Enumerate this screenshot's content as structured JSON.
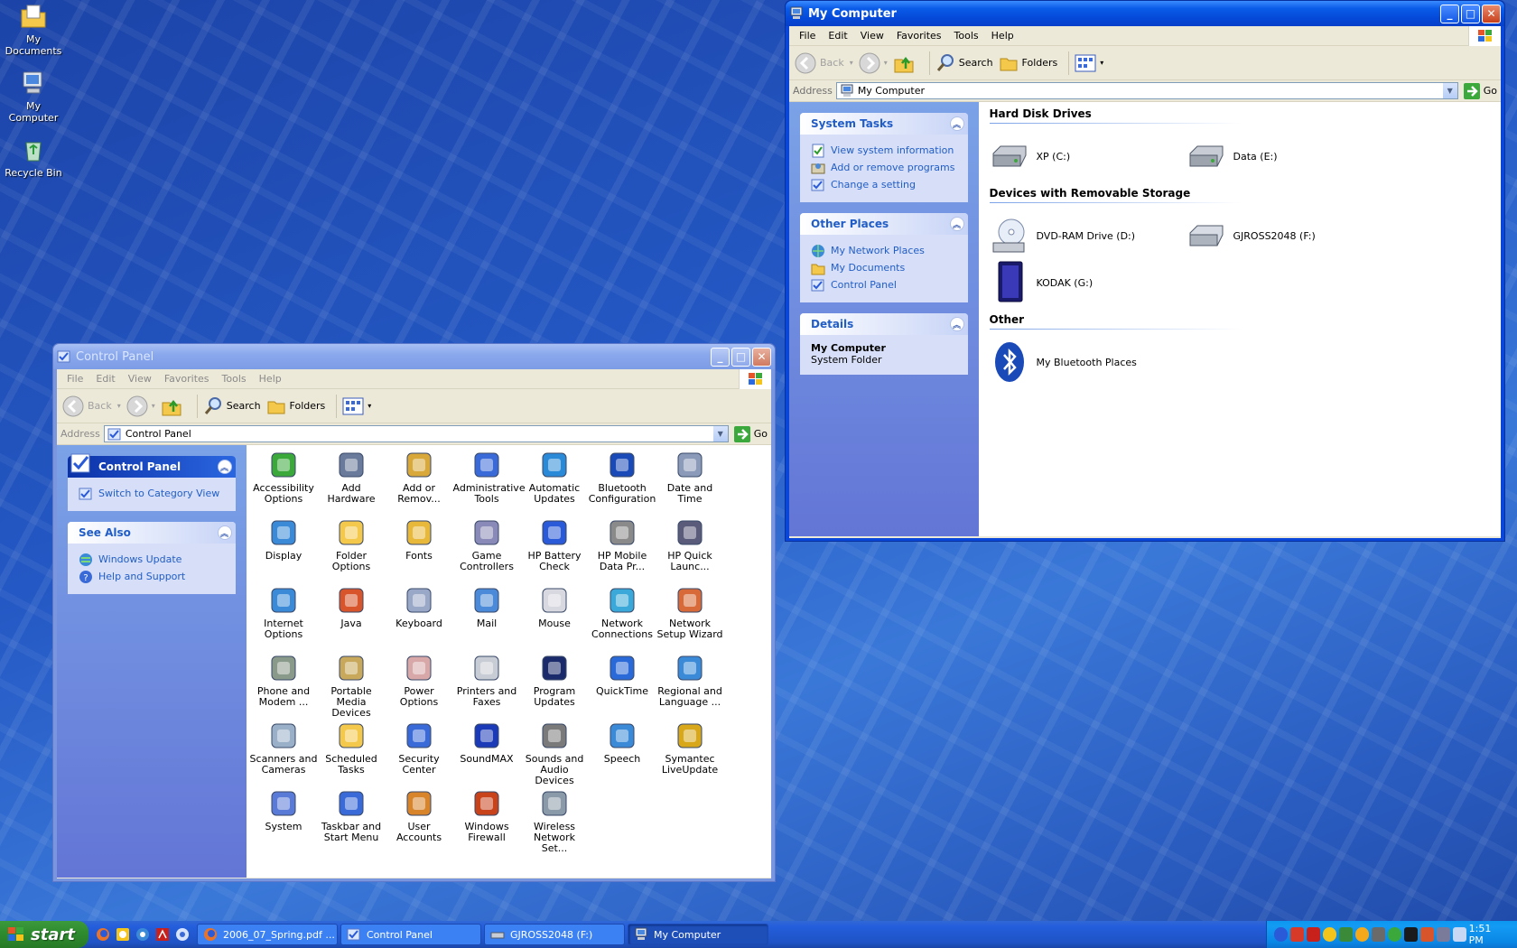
{
  "desktop": {
    "icons": [
      {
        "label": "My Documents"
      },
      {
        "label": "My Computer"
      },
      {
        "label": "Recycle Bin"
      }
    ]
  },
  "control_panel": {
    "title": "Control Panel",
    "menu": [
      "File",
      "Edit",
      "View",
      "Favorites",
      "Tools",
      "Help"
    ],
    "toolbar": {
      "back": "Back",
      "search": "Search",
      "folders": "Folders"
    },
    "address_label": "Address",
    "address_value": "Control Panel",
    "go": "Go",
    "panel_main": {
      "title": "Control Panel",
      "link": "Switch to Category View"
    },
    "panel_see_also": {
      "title": "See Also",
      "links": [
        "Windows Update",
        "Help and Support"
      ]
    },
    "items": [
      "Accessibility Options",
      "Add Hardware",
      "Add or Remov...",
      "Administrative Tools",
      "Automatic Updates",
      "Bluetooth Configuration",
      "Date and Time",
      "Display",
      "Folder Options",
      "Fonts",
      "Game Controllers",
      "HP Battery Check",
      "HP Mobile Data Pr...",
      "HP Quick Launc...",
      "Internet Options",
      "Java",
      "Keyboard",
      "Mail",
      "Mouse",
      "Network Connections",
      "Network Setup Wizard",
      "Phone and Modem ...",
      "Portable Media Devices",
      "Power Options",
      "Printers and Faxes",
      "Program Updates",
      "QuickTime",
      "Regional and Language ...",
      "Scanners and Cameras",
      "Scheduled Tasks",
      "Security Center",
      "SoundMAX",
      "Sounds and Audio Devices",
      "Speech",
      "Symantec LiveUpdate",
      "System",
      "Taskbar and Start Menu",
      "User Accounts",
      "Windows Firewall",
      "Wireless Network Set..."
    ]
  },
  "my_computer": {
    "title": "My Computer",
    "menu": [
      "File",
      "Edit",
      "View",
      "Favorites",
      "Tools",
      "Help"
    ],
    "toolbar": {
      "back": "Back",
      "search": "Search",
      "folders": "Folders"
    },
    "address_label": "Address",
    "address_value": "My Computer",
    "go": "Go",
    "system_tasks": {
      "title": "System Tasks",
      "links": [
        "View system information",
        "Add or remove programs",
        "Change a setting"
      ]
    },
    "other_places": {
      "title": "Other Places",
      "links": [
        "My Network Places",
        "My Documents",
        "Control Panel"
      ]
    },
    "details": {
      "title": "Details",
      "name": "My Computer",
      "type": "System Folder"
    },
    "groups": {
      "hard_disk": {
        "title": "Hard Disk Drives",
        "items": [
          "XP (C:)",
          "Data (E:)"
        ]
      },
      "removable": {
        "title": "Devices with Removable Storage",
        "items": [
          "DVD-RAM Drive (D:)",
          "GJROSS2048 (F:)",
          "KODAK (G:)"
        ]
      },
      "other": {
        "title": "Other",
        "items": [
          "My Bluetooth Places"
        ]
      }
    }
  },
  "taskbar": {
    "start": "start",
    "tasks": [
      "2006_07_Spring.pdf ...",
      "Control Panel",
      "GJROSS2048 (F:)",
      "My Computer"
    ],
    "clock": "1:51 PM"
  }
}
